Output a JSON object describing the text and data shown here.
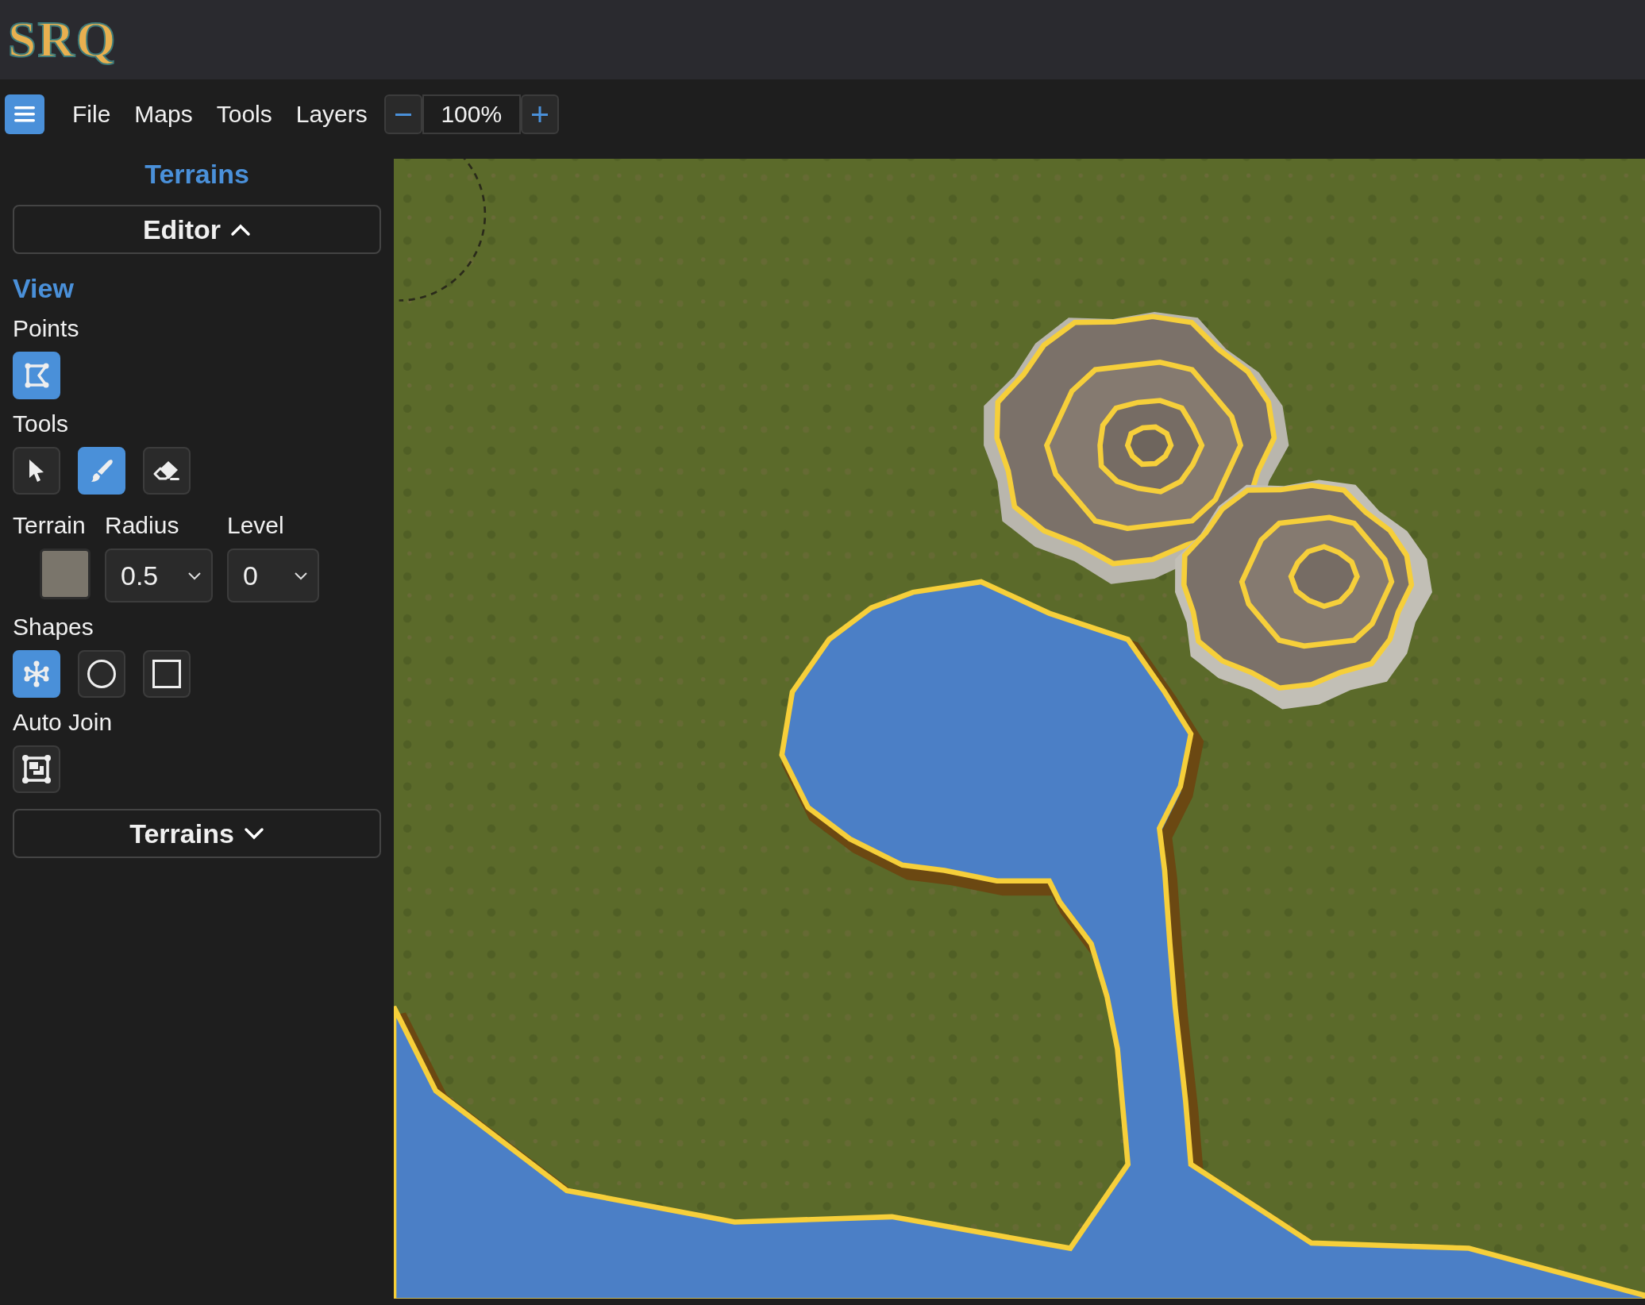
{
  "app": {
    "logo": "SRQ"
  },
  "menu": {
    "items": [
      "File",
      "Maps",
      "Tools",
      "Layers"
    ]
  },
  "zoom": {
    "value": "100%"
  },
  "sidebar": {
    "title": "Terrains",
    "editor": {
      "label": "Editor",
      "expanded": true
    },
    "view_heading": "View",
    "points": {
      "label": "Points",
      "on": true
    },
    "tools": {
      "label": "Tools",
      "items": [
        {
          "kind": "pointer",
          "selected": false
        },
        {
          "kind": "brush",
          "selected": true
        },
        {
          "kind": "eraser",
          "selected": false
        }
      ]
    },
    "terrain": {
      "label": "Terrain",
      "color": "#7a756b"
    },
    "radius": {
      "label": "Radius",
      "value": "0.5"
    },
    "level": {
      "label": "Level",
      "value": "0"
    },
    "shapes": {
      "label": "Shapes",
      "items": [
        {
          "kind": "freeform",
          "selected": true
        },
        {
          "kind": "circle",
          "selected": false
        },
        {
          "kind": "square",
          "selected": false
        }
      ]
    },
    "auto_join": {
      "label": "Auto Join",
      "on": false
    },
    "terrains_section": {
      "label": "Terrains",
      "expanded": false
    }
  }
}
